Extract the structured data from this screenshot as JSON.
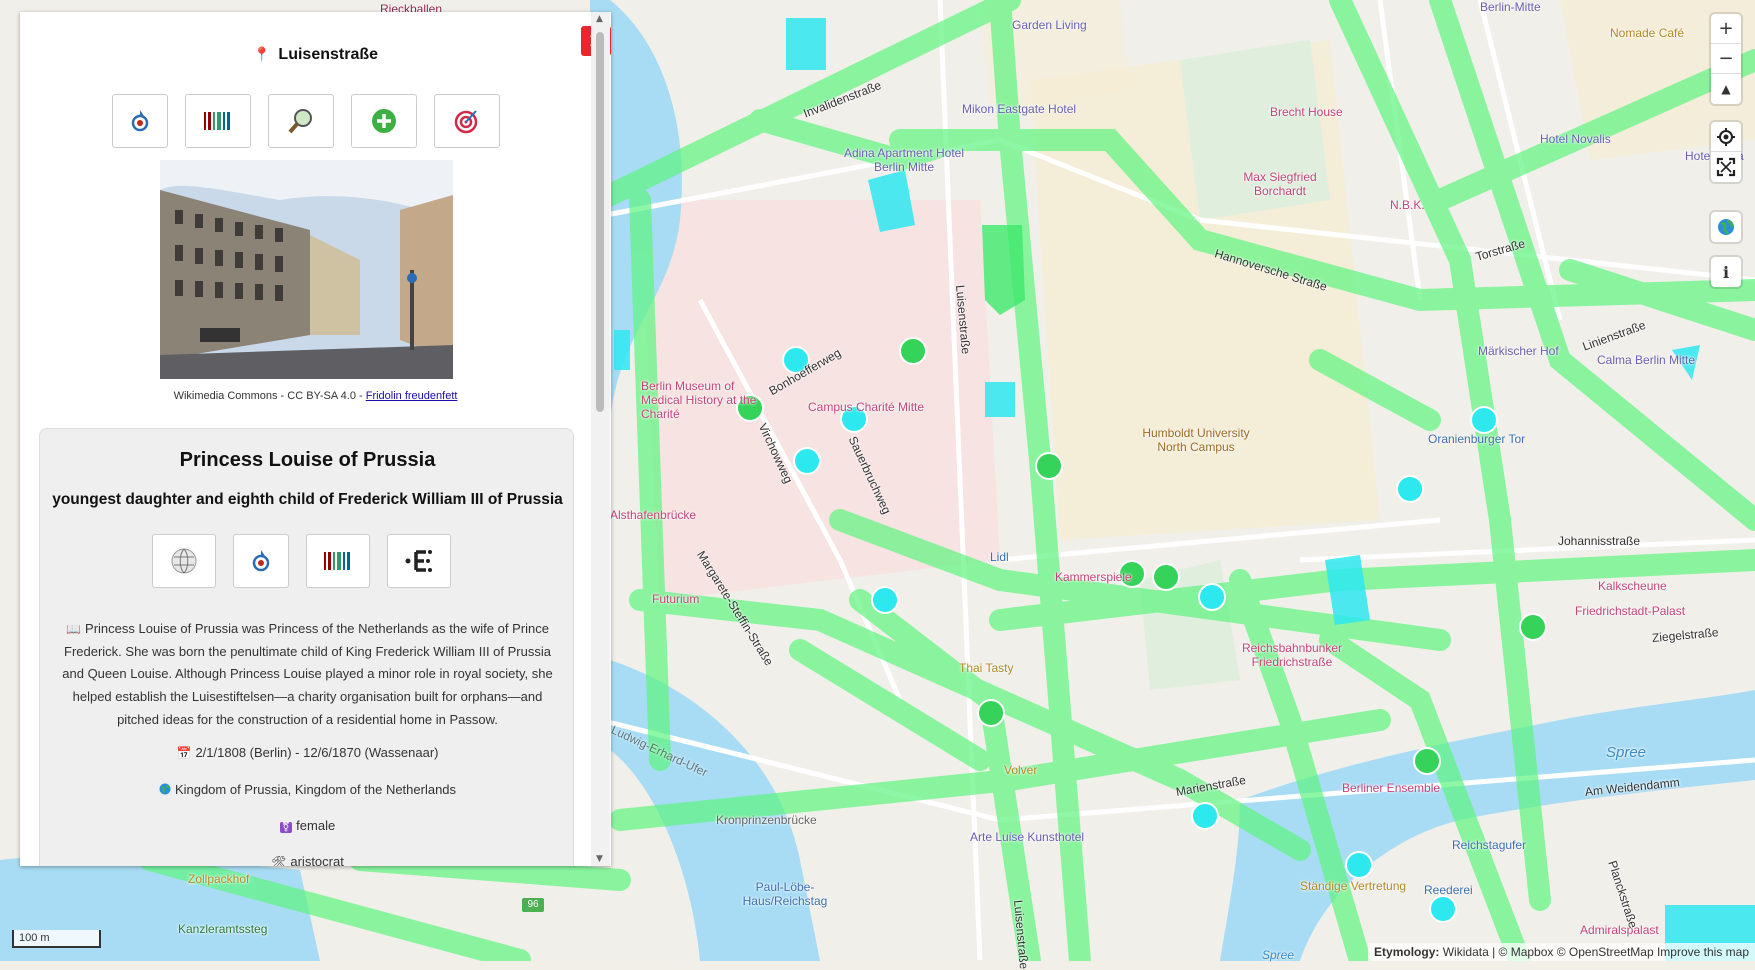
{
  "panel": {
    "feature_title": "Luisenstraße",
    "pin_icon": "map-pin-icon",
    "close_label": "✕",
    "top_buttons": [
      {
        "name": "wikimedia-commons-button",
        "icon": "commons-icon"
      },
      {
        "name": "wikidata-button",
        "icon": "wikidata-barcode-icon"
      },
      {
        "name": "osm-inspector-button",
        "icon": "magnifier-map-icon"
      },
      {
        "name": "openstreetmap-edit-button",
        "icon": "plus-circle-icon"
      },
      {
        "name": "reasonator-button",
        "icon": "target-icon"
      }
    ],
    "photo_caption_prefix": "Wikimedia Commons - CC BY-SA 4.0 - ",
    "photo_caption_author": "Fridolin freudenfett",
    "entity": {
      "name": "Princess Louise of Prussia",
      "description": "youngest daughter and eighth child of Frederick William III of Prussia",
      "buttons": [
        {
          "name": "wikipedia-button",
          "icon": "wikipedia-globe-icon"
        },
        {
          "name": "commons-button",
          "icon": "commons-icon"
        },
        {
          "name": "wikidata-entity-button",
          "icon": "wikidata-barcode-icon"
        },
        {
          "name": "entitree-button",
          "icon": "entitree-icon"
        }
      ],
      "abstract_icon": "📖",
      "abstract": "Princess Louise of Prussia was Princess of the Netherlands as the wife of Prince Frederick. She was born the penultimate child of King Frederick William III of Prussia and Queen Louise. Although Princess Louise played a minor role in royal society, she helped establish the Luisestiftelsen—a charity organisation built for orphans—and pitched ideas for the construction of a residential home in Passow.",
      "dates_icon": "📅",
      "dates": "2/1/1808 (Berlin) - 12/6/1870 (Wassenaar)",
      "citizenship_icon": "globe-icon",
      "citizenship": "Kingdom of Prussia, Kingdom of the Netherlands",
      "gender_icon": "⚧",
      "gender": "female",
      "occupation_icon": "🛠",
      "occupation": "aristocrat"
    }
  },
  "map_controls": {
    "zoom_in": "+",
    "zoom_out": "−",
    "compass": "▲",
    "geolocate_icon": "target-location-icon",
    "fullscreen_icon": "fullscreen-icon",
    "globe_icon": "globe-icon",
    "info": "i"
  },
  "scale": "100 m",
  "attribution": {
    "label": "Etymology:",
    "text": "Wikidata | © Mapbox © OpenStreetMap Improve this map"
  },
  "map_labels": {
    "places": [
      "Rieckballen",
      "Garden Living",
      "Nomade Café",
      "Berlin-Mitte",
      "Mikon Eastgate Hotel",
      "Brecht House",
      "Hotel Novalis",
      "Hotel Adria",
      "Adina Apartment Hotel Berlin Mitte",
      "Max Siegfried Borchardt",
      "N.B.K.",
      "Märkischer Hof",
      "Calma Berlin Mitte",
      "Berlin Museum of Medical History at the Charité",
      "Campus Charité Mitte",
      "Humboldt University North Campus",
      "Oranienburger Tor",
      "Lidl",
      "Kammerspiele",
      "Futurium",
      "Thai Tasty",
      "Reichsbahnbunker Friedrichstraße",
      "Kalkscheune",
      "Friedrichstadt-Palast",
      "Volver",
      "Berliner Ensemble",
      "Arte Luise Kunsthotel",
      "Kronprinzenbrücke",
      "Paul-Löbe-Haus/Reichstag",
      "Reichstagufer",
      "Reederei",
      "Ständige Vertretung",
      "Admiralspalast",
      "Zollpackhof",
      "Kanzleramtssteg",
      "Alsthafenbrücke",
      "Spree",
      "Spree"
    ],
    "streets": [
      "Invalidenstraße",
      "Luisenstraße",
      "Hannoversche Straße",
      "Torstraße",
      "Linienstraße",
      "Johannisstraße",
      "Ziegelstraße",
      "Marienstraße",
      "Am Weidendamm",
      "Planckstraße",
      "Margarete-Steffin-Straße",
      "Bonhoefferweg",
      "Virchowweg",
      "Sauerbruchweg",
      "Luisenstraße",
      "Ludwig-Erhard-Ufer"
    ],
    "road_number": "96"
  }
}
